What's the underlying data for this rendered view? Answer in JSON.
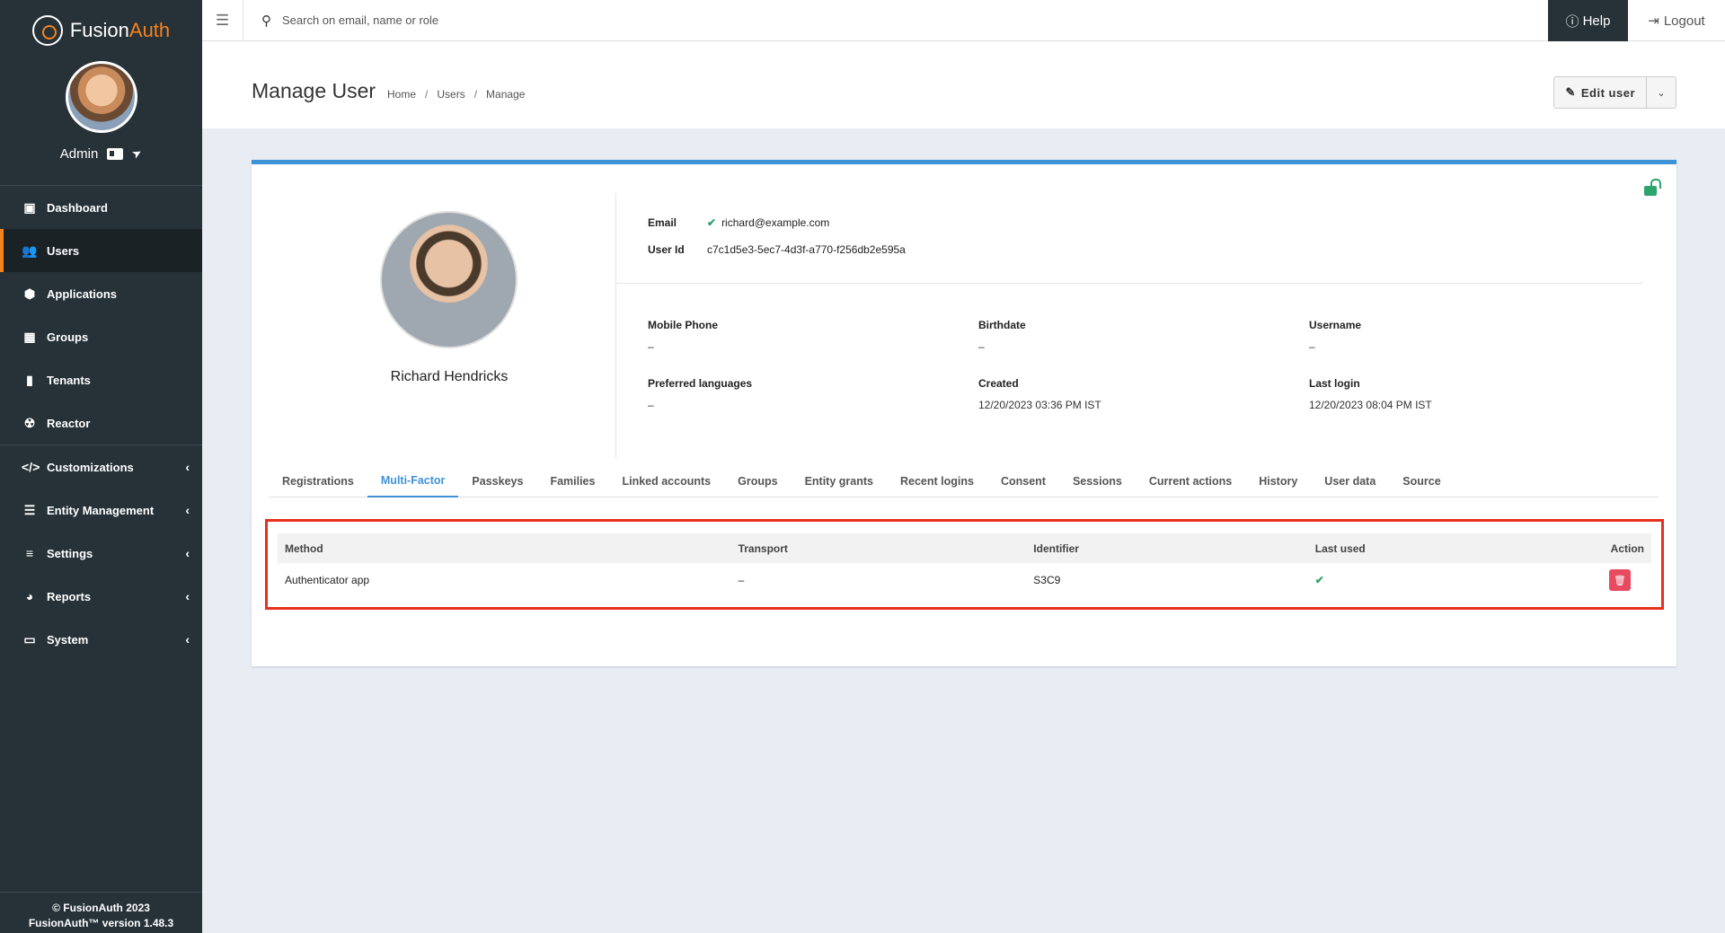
{
  "brand": {
    "part1": "Fusion",
    "part2": "Auth"
  },
  "user_menu": {
    "name": "Admin"
  },
  "sidebar": {
    "items": [
      {
        "label": "Dashboard",
        "icon": "dashboard-icon"
      },
      {
        "label": "Users",
        "icon": "users-icon"
      },
      {
        "label": "Applications",
        "icon": "cube-icon"
      },
      {
        "label": "Groups",
        "icon": "groups-icon"
      },
      {
        "label": "Tenants",
        "icon": "building-icon"
      },
      {
        "label": "Reactor",
        "icon": "reactor-icon"
      },
      {
        "label": "Customizations",
        "icon": "code-icon"
      },
      {
        "label": "Entity Management",
        "icon": "list-icon"
      },
      {
        "label": "Settings",
        "icon": "sliders-icon"
      },
      {
        "label": "Reports",
        "icon": "pie-chart-icon"
      },
      {
        "label": "System",
        "icon": "monitor-icon"
      }
    ],
    "footer_line1": "© FusionAuth 2023",
    "footer_line2": "FusionAuth™ version 1.48.3"
  },
  "topbar": {
    "search_placeholder": "Search on email, name or role",
    "help_label": "Help",
    "logout_label": "Logout"
  },
  "page": {
    "title": "Manage User",
    "breadcrumb": [
      "Home",
      "Users",
      "Manage"
    ],
    "edit_label": "Edit user"
  },
  "profile": {
    "name": "Richard Hendricks",
    "email_label": "Email",
    "email": "richard@example.com",
    "userid_label": "User Id",
    "userid": "c7c1d5e3-5ec7-4d3f-a770-f256db2e595a",
    "fields": [
      {
        "label": "Mobile Phone",
        "value": "–"
      },
      {
        "label": "Birthdate",
        "value": "–"
      },
      {
        "label": "Username",
        "value": "–"
      },
      {
        "label": "Preferred languages",
        "value": "–"
      },
      {
        "label": "Created",
        "value": "12/20/2023 03:36 PM IST"
      },
      {
        "label": "Last login",
        "value": "12/20/2023 08:04 PM IST"
      }
    ]
  },
  "tabs": [
    "Registrations",
    "Multi-Factor",
    "Passkeys",
    "Families",
    "Linked accounts",
    "Groups",
    "Entity grants",
    "Recent logins",
    "Consent",
    "Sessions",
    "Current actions",
    "History",
    "User data",
    "Source"
  ],
  "active_tab": "Multi-Factor",
  "mfa": {
    "columns": [
      "Method",
      "Transport",
      "Identifier",
      "Last used",
      "Action"
    ],
    "rows": [
      {
        "method": "Authenticator app",
        "transport": "–",
        "identifier": "S3C9",
        "last_used": "✔"
      }
    ]
  },
  "colors": {
    "accent": "#3f92d6",
    "brand_orange": "#f58320",
    "sidebar_bg": "#263238",
    "highlight_red": "#e8301c",
    "success_green": "#2ea36c",
    "danger": "#e84a5f"
  }
}
